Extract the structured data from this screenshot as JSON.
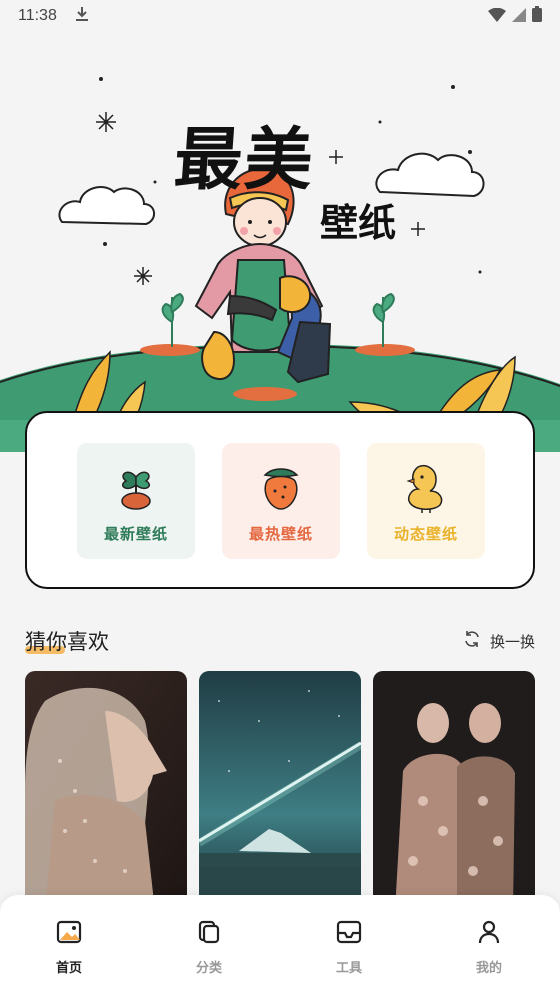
{
  "status_bar": {
    "time": "11:38"
  },
  "hero": {
    "title": "最美",
    "subtitle": "壁纸"
  },
  "categories": [
    {
      "label": "最新壁纸",
      "icon": "clover-pot-icon",
      "color": "#2f7c5a"
    },
    {
      "label": "最热壁纸",
      "icon": "fruit-icon",
      "color": "#e4673f"
    },
    {
      "label": "动态壁纸",
      "icon": "chick-icon",
      "color": "#e9b22a"
    }
  ],
  "recommend": {
    "title": "猜你喜欢",
    "refresh_label": "换一换"
  },
  "photos": [
    {
      "subject": "veiled-woman-photo"
    },
    {
      "subject": "starry-mountain-lake-photo"
    },
    {
      "subject": "two-models-floral-dress-photo"
    }
  ],
  "nav": {
    "items": [
      {
        "label": "首页",
        "icon": "image-icon",
        "active": true
      },
      {
        "label": "分类",
        "icon": "category-icon",
        "active": false
      },
      {
        "label": "工具",
        "icon": "inbox-icon",
        "active": false
      },
      {
        "label": "我的",
        "icon": "user-icon",
        "active": false
      }
    ]
  }
}
